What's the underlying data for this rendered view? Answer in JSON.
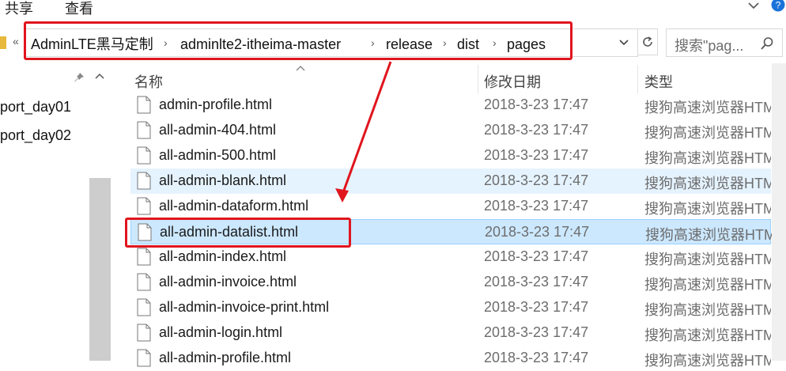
{
  "ribbon": {
    "tabs": [
      "共享",
      "查看"
    ],
    "collapse_icon": "chevron-down-icon",
    "help_icon": "help-icon"
  },
  "address": {
    "overflow": "«",
    "crumbs": [
      "AdminLTE黑马定制",
      "adminlte2-itheima-master",
      "release",
      "dist",
      "pages"
    ],
    "dropdown_icon": "chevron-down-icon",
    "refresh_icon": "refresh-icon"
  },
  "search": {
    "placeholder": "搜索\"pag...",
    "icon": "search-icon"
  },
  "nav": {
    "pin_icon": "pin-icon",
    "up_icon": "chevron-up-icon",
    "items": [
      "port_day01",
      "port_day02"
    ]
  },
  "columns": {
    "name": "名称",
    "date": "修改日期",
    "type": "类型",
    "sort_icon": "chevron-up-icon"
  },
  "files": [
    {
      "name": "admin-profile.html",
      "date": "2018-3-23 17:47",
      "type": "搜狗高速浏览器HTML"
    },
    {
      "name": "all-admin-404.html",
      "date": "2018-3-23 17:47",
      "type": "搜狗高速浏览器HTML"
    },
    {
      "name": "all-admin-500.html",
      "date": "2018-3-23 17:47",
      "type": "搜狗高速浏览器HTML"
    },
    {
      "name": "all-admin-blank.html",
      "date": "2018-3-23 17:47",
      "type": "搜狗高速浏览器HTML"
    },
    {
      "name": "all-admin-dataform.html",
      "date": "2018-3-23 17:47",
      "type": "搜狗高速浏览器HTML"
    },
    {
      "name": "all-admin-datalist.html",
      "date": "2018-3-23 17:47",
      "type": "搜狗高速浏览器HTML"
    },
    {
      "name": "all-admin-index.html",
      "date": "2018-3-23 17:47",
      "type": "搜狗高速浏览器HTML"
    },
    {
      "name": "all-admin-invoice.html",
      "date": "2018-3-23 17:47",
      "type": "搜狗高速浏览器HTML"
    },
    {
      "name": "all-admin-invoice-print.html",
      "date": "2018-3-23 17:47",
      "type": "搜狗高速浏览器HTML"
    },
    {
      "name": "all-admin-login.html",
      "date": "2018-3-23 17:47",
      "type": "搜狗高速浏览器HTML"
    },
    {
      "name": "all-admin-profile.html",
      "date": "2018-3-23 17:47",
      "type": "搜狗高速浏览器HTML"
    }
  ],
  "hover_row": 3,
  "selected_row": 5,
  "annotation_color": "#e0151e"
}
